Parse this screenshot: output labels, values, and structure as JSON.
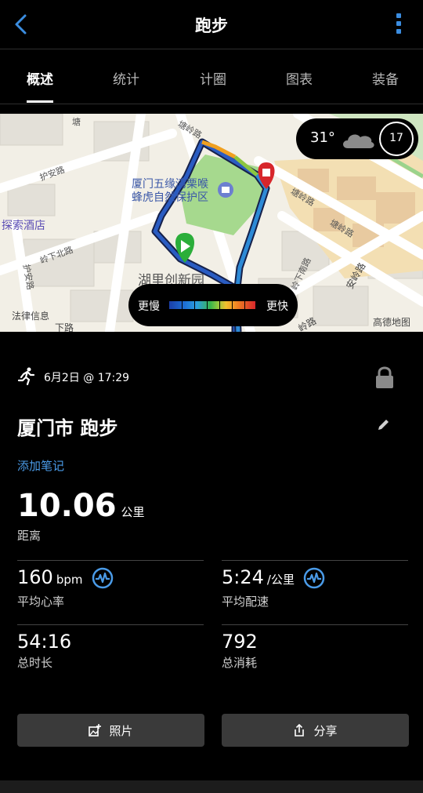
{
  "header": {
    "title": "跑步",
    "back_icon": "chevron-left-icon",
    "more_icon": "more-vertical-icon",
    "accent": "#3b8de0"
  },
  "tabs": [
    {
      "label": "概述",
      "active": true
    },
    {
      "label": "统计",
      "active": false
    },
    {
      "label": "计圈",
      "active": false
    },
    {
      "label": "图表",
      "active": false
    },
    {
      "label": "装备",
      "active": false
    }
  ],
  "map": {
    "labels": {
      "park": "厦门五缘湾栗喉\n蜂虎自然保护区",
      "hotel": "探索酒店",
      "area": "湖里创新园",
      "legal": "法律信息",
      "provider": "高德地图",
      "road1": "护安路",
      "road2": "岭下北路",
      "road3": "护安路",
      "road4": "塘岭路",
      "road5": "塘岭路",
      "road6": "塘岭路",
      "road7": "安岭路",
      "road8": "岭下南路",
      "road9": "岭路",
      "road10": "下路",
      "road11": "塘"
    },
    "weather": {
      "temperature": "31°",
      "condition_icon": "cloudy-icon",
      "wind_speed": "17"
    },
    "legend": {
      "slow": "更慢",
      "fast": "更快"
    }
  },
  "activity": {
    "type_icon": "running-icon",
    "datetime": "6月2日 @ 17:29",
    "title": "厦门市 跑步",
    "add_note": "添加笔记",
    "distance": {
      "value": "10.06",
      "unit": "公里",
      "label": "距离"
    },
    "stats": [
      {
        "value": "160",
        "unit": "bpm",
        "label": "平均心率",
        "icon": "heart-rate-icon"
      },
      {
        "value": "5:24",
        "unit": "/公里",
        "label": "平均配速",
        "icon": "heart-rate-icon"
      },
      {
        "value": "54:16",
        "unit": "",
        "label": "总时长"
      },
      {
        "value": "792",
        "unit": "",
        "label": "总消耗"
      }
    ]
  },
  "actions": {
    "photo": "照片",
    "share": "分享"
  }
}
